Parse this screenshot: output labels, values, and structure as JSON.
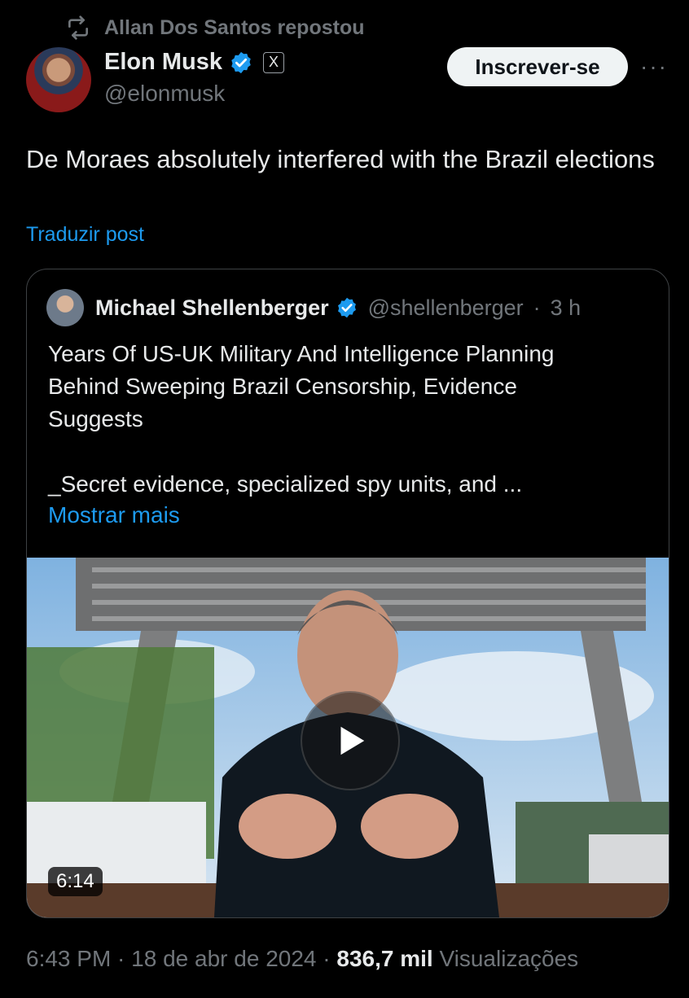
{
  "repost": {
    "text": "Allan Dos Santos repostou",
    "icon": "repost-icon"
  },
  "author": {
    "name": "Elon Musk",
    "handle": "@elonmusk",
    "badge": "verified-icon",
    "affiliation": "X"
  },
  "subscribe_label": "Inscrever-se",
  "more_label": "···",
  "post": {
    "text": "De Moraes absolutely interfered with the Brazil elections",
    "translate_label": "Traduzir post"
  },
  "quote": {
    "name": "Michael Shellenberger",
    "handle": "@shellenberger",
    "separator": "·",
    "time": "3 h",
    "text_lines": [
      "Years Of US-UK Military And Intelligence Planning",
      "Behind Sweeping Brazil Censorship, Evidence",
      "Suggests",
      "",
      "_Secret evidence, specialized spy units, and ..."
    ],
    "show_more_label": "Mostrar mais",
    "video_duration": "6:14"
  },
  "meta": {
    "time": "6:43 PM",
    "sep1": " · ",
    "date": "18 de abr de 2024",
    "sep2": " · ",
    "views_count": "836,7 mil",
    "views_label": "Visualizações"
  },
  "colors": {
    "accent": "#1d9bf0",
    "background": "#000000",
    "muted": "#71767b"
  }
}
